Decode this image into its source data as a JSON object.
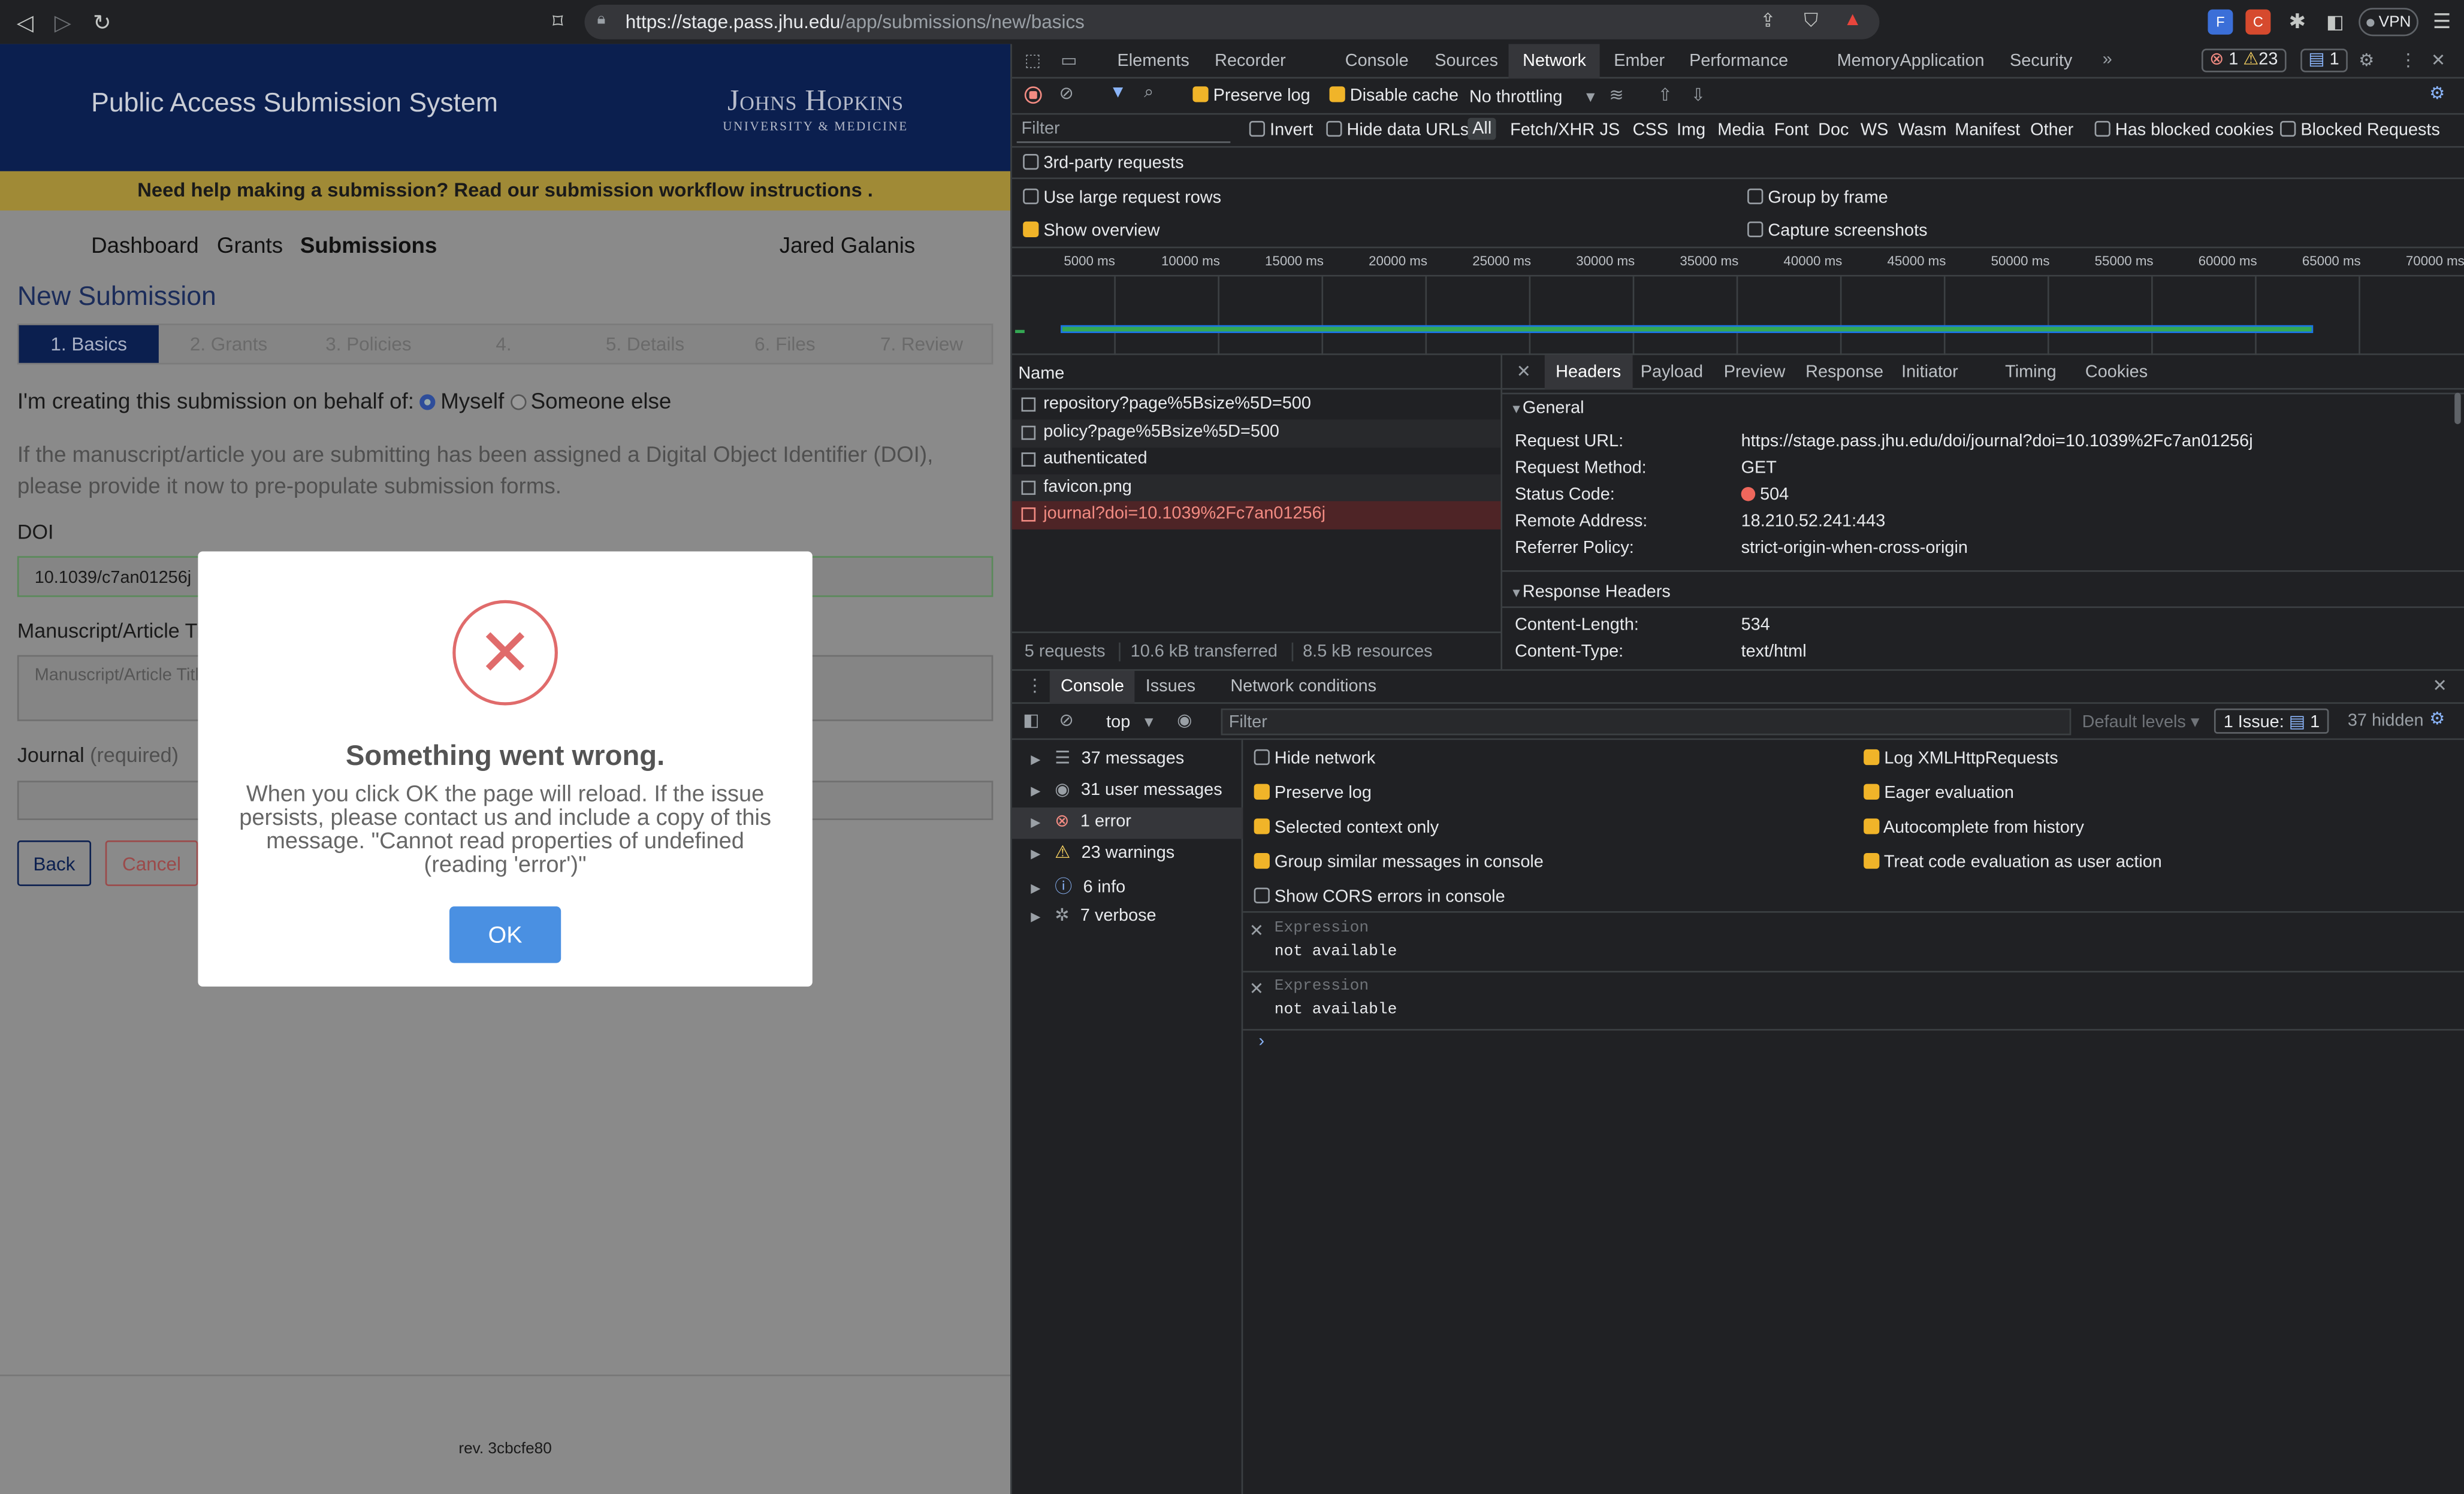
{
  "browser": {
    "url_host": "https://stage.pass.jhu.edu",
    "url_path": "/app/submissions/new/basics",
    "vpn_label": "VPN"
  },
  "app": {
    "title": "Public Access Submission System",
    "logo_line1": "Johns Hopkins",
    "logo_line2": "UNIVERSITY & MEDICINE",
    "help_text": "Need help making a submission? Read our submission workflow instructions .",
    "nav": {
      "dashboard": "Dashboard",
      "grants": "Grants",
      "submissions": "Submissions",
      "user": "Jared Galanis"
    },
    "page_title": "New Submission",
    "steps": [
      "1. Basics",
      "2. Grants",
      "3. Policies",
      "4.",
      "5. Details",
      "6. Files",
      "7. Review"
    ],
    "behalf_label": "I'm creating this submission on behalf of:",
    "behalf_myself": "Myself",
    "behalf_else": "Someone else",
    "doi_help": "If the manuscript/article you are submitting has been assigned a Digital Object Identifier (DOI), please provide it now to pre-populate submission forms.",
    "doi_label": "DOI",
    "doi_value": "10.1039/c7an01256j",
    "title_label": "Manuscript/Article Titl",
    "title_placeholder": "Manuscript/Article Title",
    "journal_label": "Journal",
    "journal_req": "(required)",
    "back": "Back",
    "cancel": "Cancel",
    "rev": "rev. 3cbcfe80"
  },
  "modal": {
    "title": "Something went wrong.",
    "message": "When you click OK the page will reload. If the issue persists, please contact us and include a copy of this message. \"Cannot read properties of undefined (reading 'error')\"",
    "ok": "OK"
  },
  "devtools": {
    "tabs": [
      "Elements",
      "Recorder",
      "Console",
      "Sources",
      "Network",
      "Ember",
      "Performance",
      "Memory",
      "Application",
      "Security"
    ],
    "selected_tab": "Network",
    "badges": {
      "errors": "1",
      "warnings": "23",
      "issues": "1"
    },
    "toolbar": {
      "preserve_log": "Preserve log",
      "disable_cache": "Disable cache",
      "throttling": "No throttling"
    },
    "filter_placeholder": "Filter",
    "filter_types": [
      "Invert",
      "Hide data URLs",
      "All",
      "Fetch/XHR",
      "JS",
      "CSS",
      "Img",
      "Media",
      "Font",
      "Doc",
      "WS",
      "Wasm",
      "Manifest",
      "Other",
      "Has blocked cookies",
      "Blocked Requests"
    ],
    "third_party": "3rd-party requests",
    "opts": {
      "large_rows": "Use large request rows",
      "group_frame": "Group by frame",
      "show_overview": "Show overview",
      "capture": "Capture screenshots"
    },
    "timeline": [
      "5000 ms",
      "10000 ms",
      "15000 ms",
      "20000 ms",
      "25000 ms",
      "30000 ms",
      "35000 ms",
      "40000 ms",
      "45000 ms",
      "50000 ms",
      "55000 ms",
      "60000 ms",
      "65000 ms",
      "70000 ms"
    ],
    "name_header": "Name",
    "requests": [
      "repository?page%5Bsize%5D=500",
      "policy?page%5Bsize%5D=500",
      "authenticated",
      "favicon.png",
      "journal?doi=10.1039%2Fc7an01256j"
    ],
    "status_bar": {
      "requests": "5 requests",
      "transferred": "10.6 kB transferred",
      "resources": "8.5 kB resources"
    },
    "detail_tabs": [
      "Headers",
      "Payload",
      "Preview",
      "Response",
      "Initiator",
      "Timing",
      "Cookies"
    ],
    "general_label": "General",
    "general": [
      {
        "k": "Request URL:",
        "v": "https://stage.pass.jhu.edu/doi/journal?doi=10.1039%2Fc7an01256j"
      },
      {
        "k": "Request Method:",
        "v": "GET"
      },
      {
        "k": "Status Code:",
        "v": "504"
      },
      {
        "k": "Remote Address:",
        "v": "18.210.52.241:443"
      },
      {
        "k": "Referrer Policy:",
        "v": "strict-origin-when-cross-origin"
      }
    ],
    "response_headers_label": "Response Headers",
    "response_headers": [
      {
        "k": "Content-Length:",
        "v": "534"
      },
      {
        "k": "Content-Type:",
        "v": "text/html"
      }
    ],
    "drawer_tabs": [
      "Console",
      "Issues",
      "Network conditions"
    ],
    "console_context": "top",
    "console_filter": "Filter",
    "default_levels": "Default levels",
    "issue_count": "1 Issue:",
    "issue_badge": "1",
    "hidden": "37 hidden",
    "sidebar": [
      "37 messages",
      "31 user messages",
      "1 error",
      "23 warnings",
      "6 info",
      "7 verbose"
    ],
    "settings_left": [
      "Hide network",
      "Preserve log",
      "Selected context only",
      "Group similar messages in console",
      "Show CORS errors in console"
    ],
    "settings_right": [
      "Log XMLHttpRequests",
      "Eager evaluation",
      "Autocomplete from history",
      "Treat code evaluation as user action"
    ],
    "expr_label": "Expression",
    "expr_value": "not available"
  },
  "colors": {
    "accent": "#4a90e2",
    "error": "#e06b6b",
    "navy": "#0b1f4f",
    "selected_tab": "#35363a"
  }
}
